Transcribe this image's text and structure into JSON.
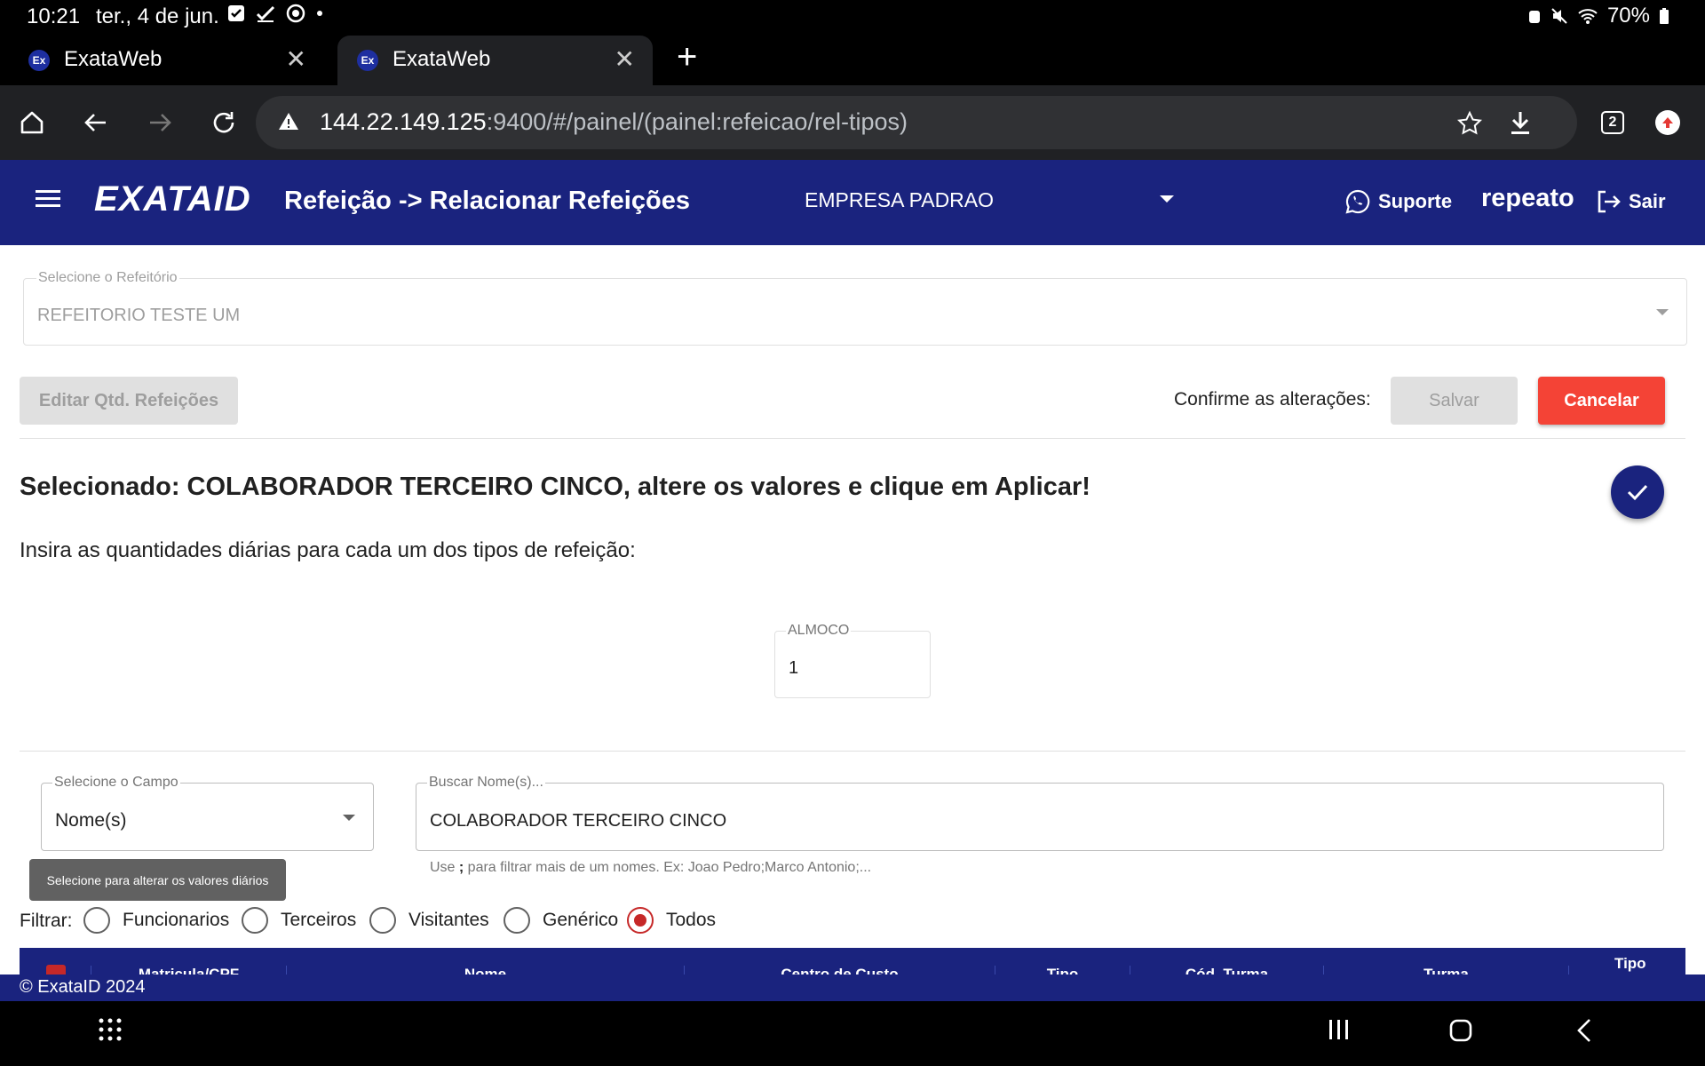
{
  "status_bar": {
    "time": "10:21",
    "date": "ter., 4 de jun.",
    "battery": "70%"
  },
  "tabs": [
    {
      "favicon": "Ex",
      "title": "ExataWeb"
    },
    {
      "favicon": "Ex",
      "title": "ExataWeb"
    }
  ],
  "address_bar": {
    "url_host": "144.22.149.125",
    "url_path": ":9400/#/painel/(painel:refeicao/rel-tipos)",
    "tab_count": "2"
  },
  "header": {
    "logo": "EXATAID",
    "title": "Refeição -> Relacionar Refeições",
    "company": "EMPRESA PADRAO",
    "support": "Suporte",
    "user": "repeato",
    "logout": "Sair"
  },
  "refeitorio": {
    "label": "Selecione o Refeitório",
    "value": "REFEITORIO TESTE UM"
  },
  "actions": {
    "edit": "Editar Qtd. Refeições",
    "confirm_label": "Confirme as alterações:",
    "save": "Salvar",
    "cancel": "Cancelar"
  },
  "selection": {
    "heading": "Selecionado: COLABORADOR TERCEIRO CINCO, altere os valores e clique em Aplicar!",
    "instruction": "Insira as quantidades diárias para cada um dos tipos de refeição:"
  },
  "meal": {
    "label": "ALMOCO",
    "value": "1"
  },
  "search": {
    "field_label": "Selecione o Campo",
    "field_value": "Nome(s)",
    "query_label": "Buscar Nome(s)...",
    "query_value": "COLABORADOR TERCEIRO CINCO",
    "hint_prefix": "Use ",
    "hint_sep": ";",
    "hint_suffix": " para filtrar mais de um nomes. Ex: Joao Pedro;Marco Antonio;..."
  },
  "tooltip": "Selecione para alterar os valores diários",
  "filter": {
    "label": "Filtrar:",
    "options": [
      "Funcionarios",
      "Terceiros",
      "Visitantes",
      "Genérico",
      "Todos"
    ],
    "selected": "Todos"
  },
  "table": {
    "columns": [
      "Matricula/CPF",
      "Nome",
      "Centro de Custo",
      "Tipo",
      "Cód. Turma",
      "Turma",
      "Tipo"
    ]
  },
  "footer": "© ExataID 2024",
  "colors": {
    "primary": "#1a237e",
    "danger": "#f44336",
    "radio_selected": "#c62828"
  }
}
